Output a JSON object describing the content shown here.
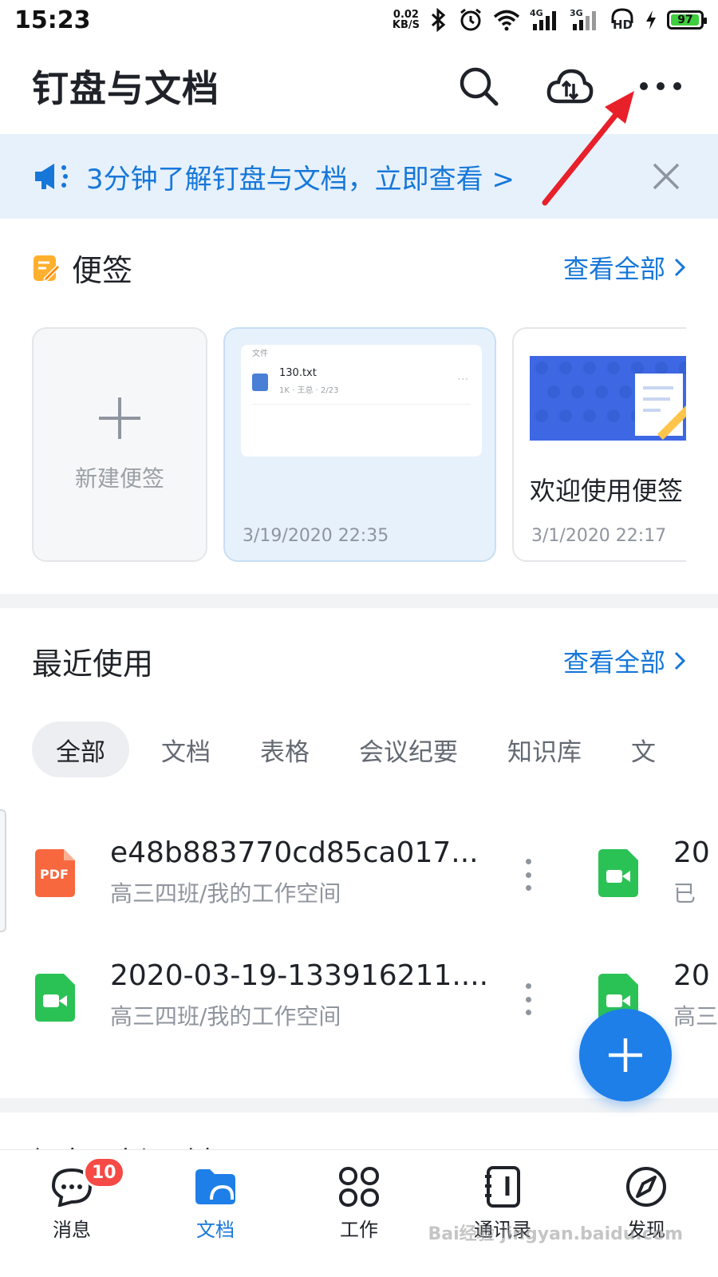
{
  "status_bar": {
    "time": "15:23",
    "net_speed_value": "0.02",
    "net_speed_unit": "KB/S",
    "network_4g": "4G",
    "network_3g": "3G",
    "hd": "HD",
    "battery": "97",
    "icons": [
      "bluetooth-icon",
      "alarm-icon",
      "wifi-icon",
      "signal-icon",
      "headphone-icon",
      "charging-icon",
      "battery-icon"
    ]
  },
  "header": {
    "title": "钉盘与文档",
    "icons": [
      "search-icon",
      "cloud-transfer-icon",
      "more-horizontal-icon"
    ]
  },
  "banner": {
    "text": "3分钟了解钉盘与文档，立即查看 >",
    "icons": [
      "megaphone-icon",
      "close-icon"
    ]
  },
  "notes": {
    "title": "便签",
    "see_all": "查看全部",
    "new_label": "新建便签",
    "cards": [
      {
        "caption": "文件",
        "file_name": "130.txt",
        "file_meta": "1K · 王总 · 2/23",
        "date": "3/19/2020 22:35"
      },
      {
        "title": "欢迎使用便签",
        "date": "3/1/2020 22:17"
      }
    ]
  },
  "recent": {
    "title": "最近使用",
    "see_all": "查看全部",
    "tabs": [
      "全部",
      "文档",
      "表格",
      "会议纪要",
      "知识库",
      "文"
    ],
    "active_tab": "全部",
    "items": [
      {
        "type": "pdf",
        "icon_label": "PDF",
        "name": "e48b883770cd85ca017...",
        "path": "高三四班/我的工作空间"
      },
      {
        "type": "video",
        "name": "2020-03-19-133916211....",
        "path": "高三四班/我的工作空间"
      }
    ],
    "col2_items": [
      {
        "type": "video",
        "name": "20",
        "path": "已"
      },
      {
        "type": "video",
        "name": "20",
        "path": "高三"
      }
    ]
  },
  "next_section_peek": "钉盘 | 空间列表",
  "bottom_nav": {
    "items": [
      {
        "label": "消息",
        "icon": "chat-icon",
        "badge": "10"
      },
      {
        "label": "文档",
        "icon": "folder-icon"
      },
      {
        "label": "工作",
        "icon": "grid-icon"
      },
      {
        "label": "通讯录",
        "icon": "contacts-icon"
      },
      {
        "label": "发现",
        "icon": "compass-icon"
      }
    ],
    "active": "文档"
  },
  "watermark": "Bai经验 jingyan.baidu.com",
  "colors": {
    "accent": "#1677d9",
    "banner_bg": "#e6f1fc",
    "pdf_orange": "#f7683e",
    "video_green": "#2bc255",
    "badge_red": "#f54a45",
    "annotation_arrow": "#e8202a"
  }
}
